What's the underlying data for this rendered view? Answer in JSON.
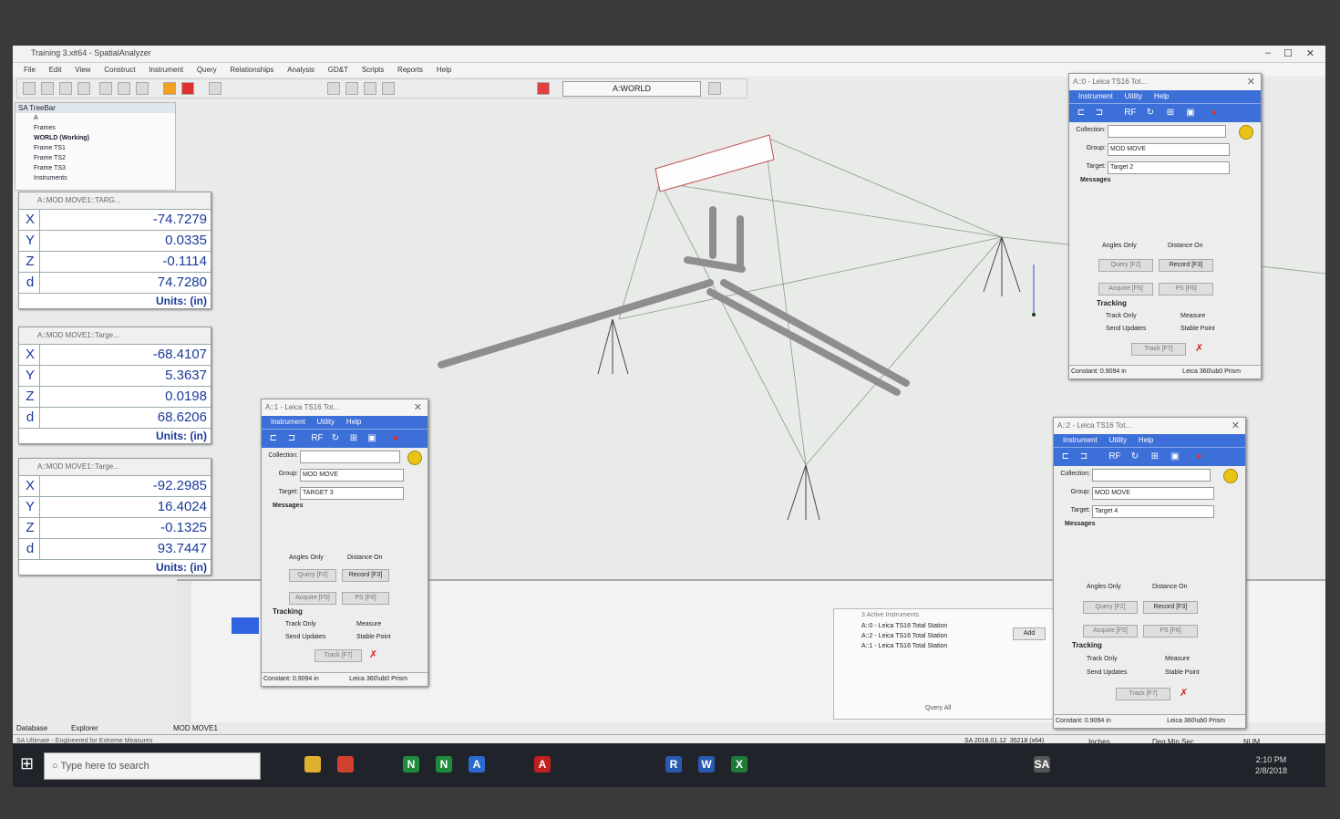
{
  "app": {
    "title": "Training 3.xit64 - SpatialAnalyzer",
    "menu": [
      "File",
      "Edit",
      "View",
      "Construct",
      "Instrument",
      "Query",
      "Relationships",
      "Analysis",
      "GD&T",
      "Scripts",
      "Reports",
      "Help"
    ],
    "frame_box": "A:WORLD"
  },
  "treebar": {
    "title": "SA TreeBar",
    "items": [
      "A",
      "Frames",
      "WORLD (Working)",
      "Frame TS1",
      "Frame TS2",
      "Frame TS3",
      "Instruments"
    ]
  },
  "coords": [
    {
      "title": "A::MOD MOVE1::TARG...",
      "x": "-74.7279",
      "y": "0.0335",
      "z": "-0.1114",
      "d": "74.7280",
      "units": "Units: (in)"
    },
    {
      "title": "A::MOD MOVE1::Targe...",
      "x": "-68.4107",
      "y": "5.3637",
      "z": "0.0198",
      "d": "68.6206",
      "units": "Units: (in)"
    },
    {
      "title": "A::MOD MOVE1::Targe...",
      "x": "-92.2985",
      "y": "16.4024",
      "z": "-0.1325",
      "d": "93.7447",
      "units": "Units: (in)"
    }
  ],
  "axis_labels": {
    "x": "X",
    "y": "Y",
    "z": "Z",
    "d": "d"
  },
  "instruments": [
    {
      "title": "A::1 - Leica TS16 Tot...",
      "menu": [
        "Instrument",
        "Utility",
        "Help"
      ],
      "collection": "",
      "group": "MOD MOVE",
      "target": "TARGET 3",
      "constant": "Constant: 0.9094 in",
      "prism": "Leica 360\\ub0 Prism"
    },
    {
      "title": "A::0 - Leica TS16 Tot...",
      "menu": [
        "Instrument",
        "Utility",
        "Help"
      ],
      "collection": "",
      "group": "MOD MOVE",
      "target": "Target 2",
      "constant": "Constant: 0.9094 in",
      "prism": "Leica 360\\ub0 Prism"
    },
    {
      "title": "A::2 - Leica TS16 Tot...",
      "menu": [
        "Instrument",
        "Utility",
        "Help"
      ],
      "collection": "",
      "group": "MOD MOVE",
      "target": "Target 4",
      "constant": "Constant: 0.9094 in",
      "prism": "Leica 360\\ub0 Prism"
    }
  ],
  "inst_labels": {
    "collection": "Collection:",
    "group": "Group:",
    "target": "Target:",
    "messages": "Messages",
    "angles_only": "Angles Only",
    "distance_on": "Distance On",
    "query": "Query [F2]",
    "record": "Record [F3]",
    "acquire": "Acquire [F5]",
    "ps": "PS [F6]",
    "tracking": "Tracking",
    "track_only": "Track Only",
    "measure": "Measure",
    "send_updates": "Send Updates",
    "stable_point": "Stable Point",
    "track": "Track [F7]"
  },
  "active_instruments": {
    "title": "3 Active Instruments",
    "rows": [
      "A::0 - Leica TS16 Total Station",
      "A::2 - Leica TS16 Total Station",
      "A::1 - Leica TS16 Total Station"
    ],
    "add": "Add",
    "query_all": "Query All"
  },
  "status": {
    "left": "Database",
    "explorer": "Explorer",
    "mod": "MOD MOVE1",
    "footer": "SA Ultimate - Engineered for Extreme Measures",
    "version": "SA 2018.01.12_35218 (x64)",
    "units": "Inches",
    "angle": "Deg.Min.Sec",
    "num": "NUM"
  },
  "taskbar": {
    "search_placeholder": "Type here to search",
    "time": "2:10 PM",
    "date": "2/8/2018"
  }
}
